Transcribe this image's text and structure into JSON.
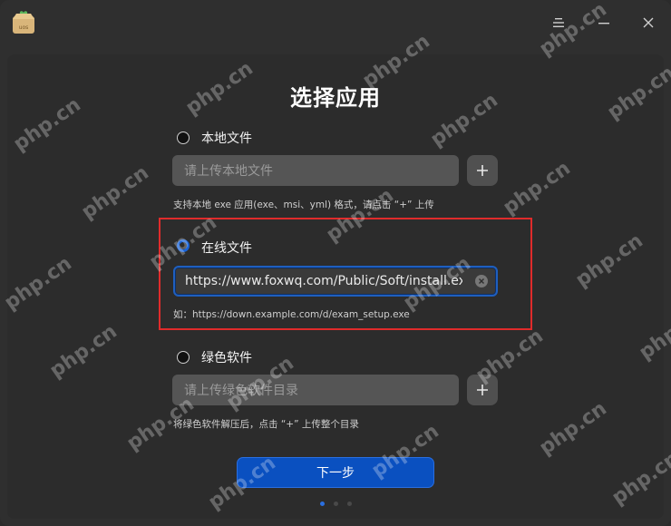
{
  "title": "选择应用",
  "options": [
    {
      "label": "本地文件",
      "placeholder": "请上传本地文件",
      "hint": "支持本地 exe 应用(exe、msi、yml) 格式，请点击 “+” 上传"
    },
    {
      "label": "在线文件",
      "value": "https://www.foxwq.com/Public/Soft/install.exe",
      "hint": "如：https://down.example.com/d/exam_setup.exe"
    },
    {
      "label": "绿色软件",
      "placeholder": "请上传绿色软件目录",
      "hint": "将绿色软件解压后，点击 “+” 上传整个目录"
    }
  ],
  "next_label": "下一步",
  "app_icon_text": "uos",
  "watermark": "php.cn",
  "colors": {
    "accent": "#0a50c0",
    "highlight": "#e02b2b"
  },
  "icons": [
    "menu-icon",
    "minimize-icon",
    "close-icon",
    "plus-icon",
    "clear-icon"
  ]
}
